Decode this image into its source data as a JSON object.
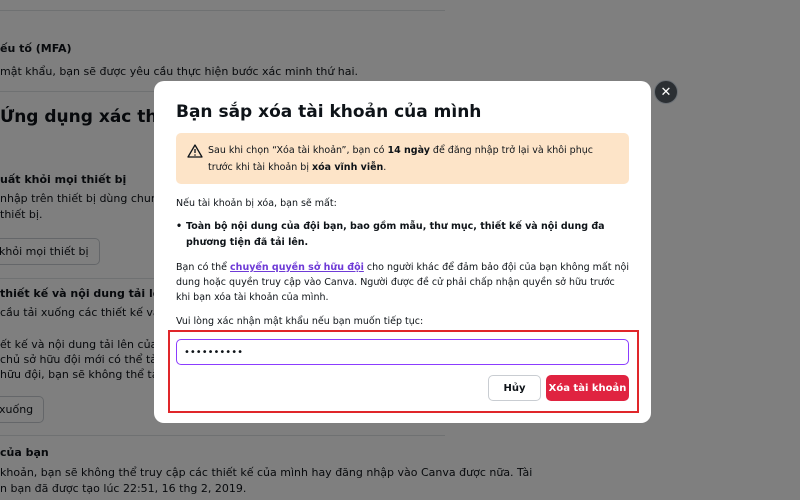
{
  "background": {
    "mfa_heading": "ếu tố (MFA)",
    "mfa_desc": "mật khẩu, bạn sẽ được yêu cầu thực hiện bước xác minh thứ hai.",
    "auth_app_heading": "Ứng dụng xác thực",
    "devices_heading": "uất khỏi mọi thiết bị",
    "devices_desc_1": "nhập trên thiết bị dùng chung nhưng",
    "devices_desc_2": "thiết bị.",
    "devices_button": "khỏi mọi thiết bị",
    "download_heading": "thiết kế và nội dung tải lên của đ",
    "download_desc_1": "cầu tải xuống các thiết kế và nội du",
    "download_desc_2": "ết kế và nội dung tải lên của đội",
    "download_desc_3": "chủ sở hữu đội mới có thể tải xuống",
    "download_desc_4": "hữu đội, bạn sẽ không thể tải xuống",
    "download_button": "xuống",
    "account_heading": "của bạn",
    "account_desc_1": "khoản, bạn sẽ không thể truy cập các thiết kế của mình hay đăng nhập vào Canva được nữa. Tài",
    "account_desc_2": "n bạn đã được tạo lúc 22:51, 16 thg 2, 2019."
  },
  "modal": {
    "title": "Bạn sắp xóa tài khoản của mình",
    "warning": {
      "icon": "warning-icon",
      "part1": "Sau khi chọn “Xóa tài khoản”, bạn có ",
      "days": "14 ngày",
      "part2": " để đăng nhập trở lại và khôi phục trước khi tài khoản bị ",
      "permanent": "xóa vĩnh viễn",
      "part3": "."
    },
    "lose_intro": "Nếu tài khoản bị xóa, bạn sẽ mất:",
    "lose_items": [
      "Toàn bộ nội dung của đội bạn, bao gồm mẫu, thư mục, thiết kế và nội dung đa phương tiện đã tải lên."
    ],
    "transfer": {
      "before": "Bạn có thể ",
      "link": "chuyển quyền sở hữu đội",
      "after": " cho người khác để đảm bảo đội của bạn không mất nội dung hoặc quyền truy cập vào Canva. Người được đề cử phải chấp nhận quyền sở hữu trước khi bạn xóa tài khoản của mình."
    },
    "password_prompt": "Vui lòng xác nhận mật khẩu nếu bạn muốn tiếp tục:",
    "password_value": "••••••••••",
    "cancel_label": "Hủy",
    "delete_label": "Xóa tài khoản"
  },
  "colors": {
    "accent_purple": "#8b3dff",
    "danger_red": "#e02340",
    "warning_bg": "#fde4c8",
    "highlight_border": "#e0262a"
  }
}
